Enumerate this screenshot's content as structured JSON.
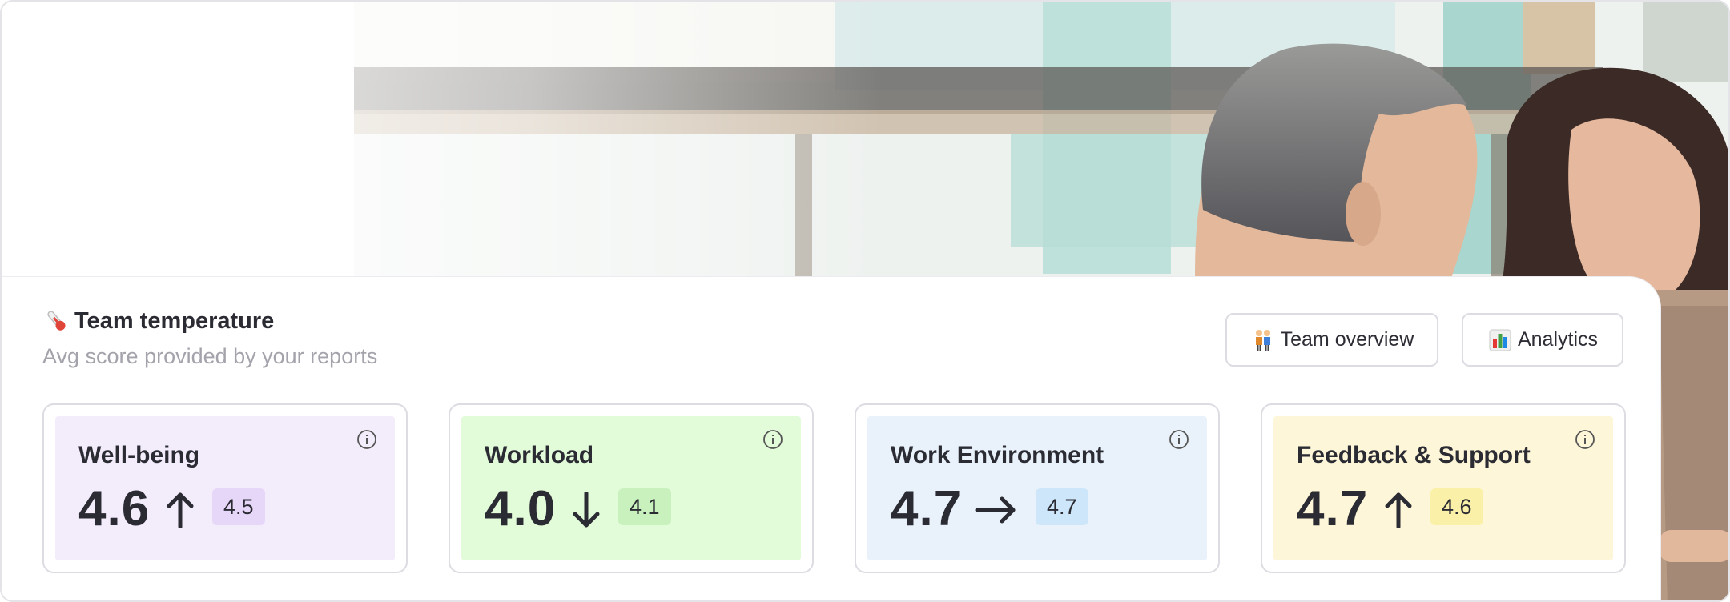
{
  "header": {
    "title": "Team temperature",
    "subtitle": "Avg score provided by your reports",
    "title_icon": "thermometer-icon"
  },
  "actions": {
    "team_overview": {
      "label": "Team overview",
      "icon": "people-icon"
    },
    "analytics": {
      "label": "Analytics",
      "icon": "bar-chart-icon"
    }
  },
  "metrics": [
    {
      "label": "Well-being",
      "score": "4.6",
      "trend": "up",
      "previous": "4.5",
      "bg": "#f3ecfb",
      "badge_bg": "#e6d6f8"
    },
    {
      "label": "Workload",
      "score": "4.0",
      "trend": "down",
      "previous": "4.1",
      "bg": "#e2fbd9",
      "badge_bg": "#c9f1bd"
    },
    {
      "label": "Work Environment",
      "score": "4.7",
      "trend": "flat",
      "previous": "4.7",
      "bg": "#e9f2fa",
      "badge_bg": "#cde6fa"
    },
    {
      "label": "Feedback & Support",
      "score": "4.7",
      "trend": "up",
      "previous": "4.6",
      "bg": "#fdf6d8",
      "badge_bg": "#fbf0a8"
    }
  ]
}
